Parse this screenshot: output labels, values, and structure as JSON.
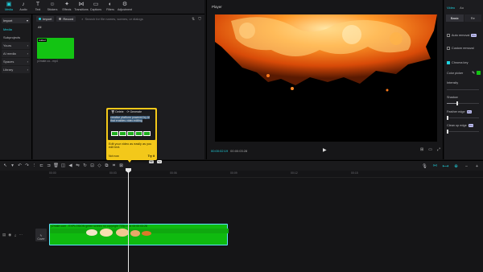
{
  "toolbar": {
    "items": [
      {
        "label": "Media",
        "icon": "media-icon",
        "glyph": "▣"
      },
      {
        "label": "Audio",
        "icon": "audio-icon",
        "glyph": "♪"
      },
      {
        "label": "Text",
        "icon": "text-icon",
        "glyph": "T"
      },
      {
        "label": "Stickers",
        "icon": "stickers-icon",
        "glyph": "☺"
      },
      {
        "label": "Effects",
        "icon": "effects-icon",
        "glyph": "✦"
      },
      {
        "label": "Transitions",
        "icon": "transitions-icon",
        "glyph": "⋈"
      },
      {
        "label": "Captions",
        "icon": "captions-icon",
        "glyph": "▭"
      },
      {
        "label": "Filters",
        "icon": "filters-icon",
        "glyph": "◐"
      },
      {
        "label": "Adjustment",
        "icon": "adjustment-icon",
        "glyph": "⚙"
      }
    ]
  },
  "sidebar": {
    "import_label": "Import",
    "media_label": "Media",
    "items": [
      {
        "label": "Subprojects"
      },
      {
        "label": "Yours"
      },
      {
        "label": "AI media"
      },
      {
        "label": "Spaces"
      },
      {
        "label": "Library"
      }
    ]
  },
  "media": {
    "import_button": "Import",
    "record_button": "Record",
    "search_placeholder": "Search for file names, scenes, or dialogs",
    "all_label": "All",
    "thumb_tag": "Added",
    "thumb_name": "y2mate.co...mp4"
  },
  "player": {
    "title": "Player",
    "timecode_current": "00:00:02:19",
    "timecode_total": "00:00:03:28"
  },
  "inspector": {
    "tabs": [
      "Video",
      "Au"
    ],
    "subtabs": [
      "Basic",
      "Re"
    ],
    "auto_removal": "Auto removal",
    "custom_removal": "Custom removal",
    "chroma_key": "Chroma key",
    "color_picker": "Color picker",
    "intensity": "Intensity",
    "shadow": "Shadow",
    "feather_edge": "Feather edge",
    "clean_up_edge": "Clean up edge",
    "pro_badge": "Pro",
    "key_color": "#13c413",
    "shadow_level": 0.3
  },
  "tooltip": {
    "delete": "Delete",
    "generate": "Generate",
    "body": "creative platform powered by AI that enables video editing",
    "message": "Edit your video as easily as you edit text.",
    "not_now": "Not now",
    "try_it": "Try it"
  },
  "timeline": {
    "ruler_labels": [
      "00:00",
      "00:03",
      "00:06",
      "00:09",
      "00:12",
      "00:15"
    ],
    "cover_label": "Cover",
    "clip_label": "y2mate.com - EXPLOSION green screen no copyright 720p.mp4  00:00:03:28",
    "playhead_tag_1": "T1",
    "playhead_tag_2": "T2"
  },
  "colors": {
    "accent": "#20d3e0",
    "green_screen": "#13c413",
    "tooltip_yellow": "#f3c81a"
  }
}
